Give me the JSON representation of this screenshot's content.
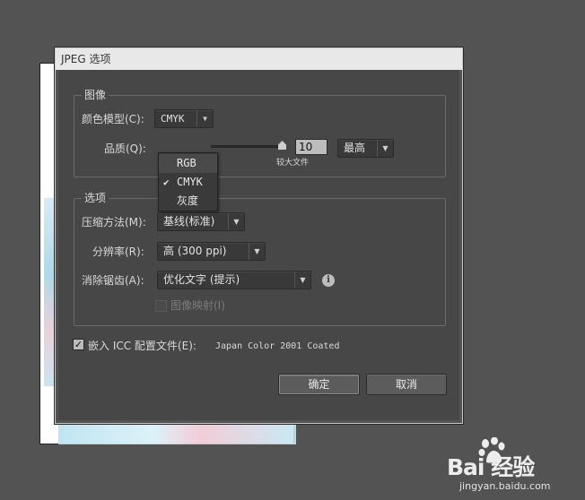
{
  "dialog": {
    "title": "JPEG 选项"
  },
  "image_group": {
    "title": "图像",
    "color_model_label": "颜色模型(C):",
    "color_model_value": "CMYK",
    "quality_label": "品质(Q):",
    "quality_value": "10",
    "quality_caption": "较大文件",
    "quality_preset": "最高"
  },
  "color_model_menu": {
    "items": [
      {
        "label": "RGB",
        "checked": false
      },
      {
        "label": "CMYK",
        "checked": true
      },
      {
        "label": "灰度",
        "checked": false
      }
    ]
  },
  "options_group": {
    "title": "选项",
    "compression_label": "压缩方法(M):",
    "compression_value": "基线(标准)",
    "resolution_label": "分辨率(R):",
    "resolution_value": "高 (300 ppi)",
    "antialias_label": "消除锯齿(A):",
    "antialias_value": "优化文字 (提示)",
    "imagemap_label": "图像映射(I)",
    "imagemap_checked": false
  },
  "embed_icc": {
    "label": "嵌入 ICC 配置文件(E):",
    "profile": "Japan Color 2001 Coated",
    "checked": true
  },
  "buttons": {
    "ok": "确定",
    "cancel": "取消"
  },
  "watermark": {
    "brand": "Bai  经验",
    "url": "jingyan.baidu.com"
  },
  "colors": {
    "background": "#535353",
    "panel": "#474747",
    "titlebar": "#e8e8e8"
  }
}
